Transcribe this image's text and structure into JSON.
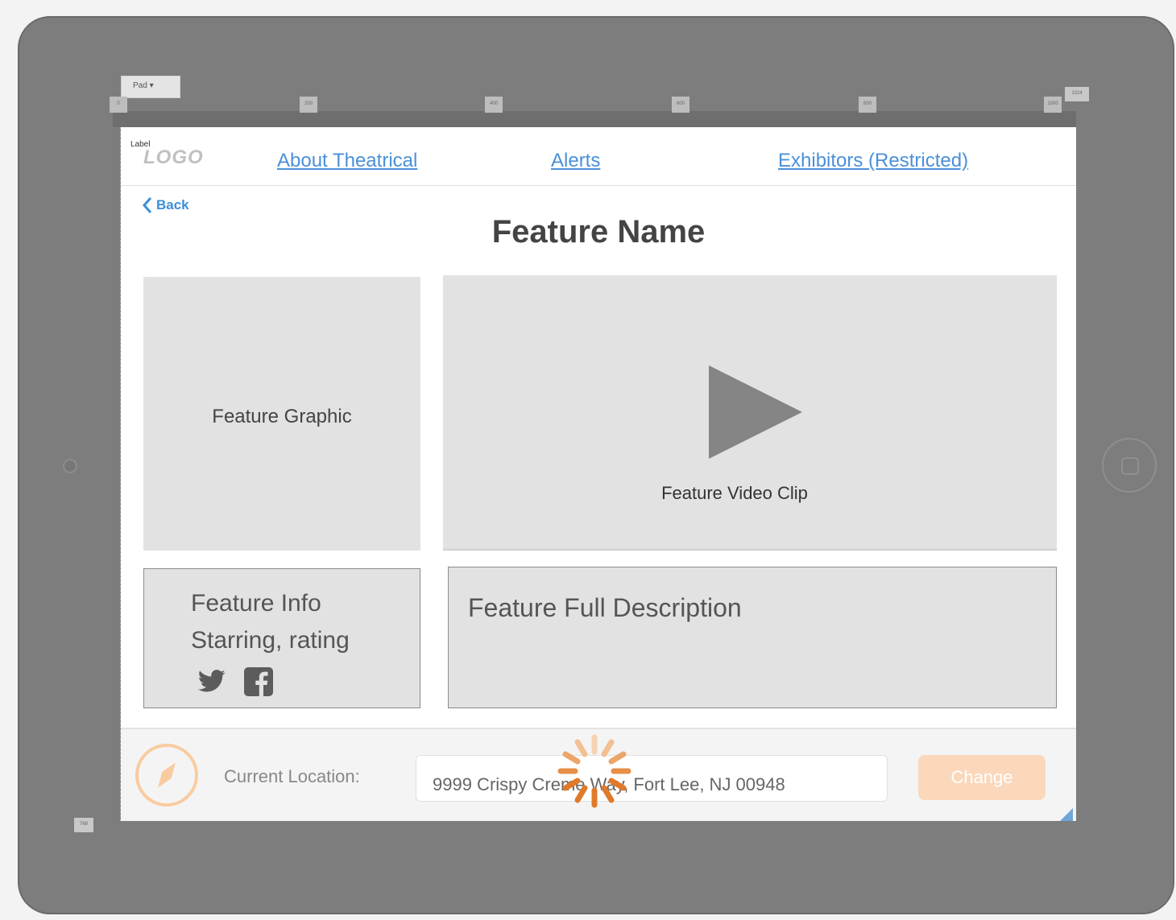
{
  "toolbar": {
    "device_select": "Pad ▾",
    "ruler_ticks": [
      "0",
      "200",
      "400",
      "600",
      "800",
      "1000"
    ],
    "corner_tag": "1024",
    "bottom_tag": "768"
  },
  "screen": {
    "label_tag": "Label",
    "logo": "LOGO",
    "nav": [
      "About Theatrical",
      "Alerts",
      "Exhibitors (Restricted)"
    ],
    "back_label": "Back",
    "title": "Feature Name"
  },
  "content": {
    "graphic_label": "Feature Graphic",
    "video_label": "Feature Video Clip",
    "info_line1": "Feature Info",
    "info_line2": "Starring, rating",
    "description_label": "Feature Full Description",
    "social_icons": [
      "twitter-icon",
      "facebook-icon"
    ]
  },
  "footer": {
    "location_label": "Current Location:",
    "location_value": "9999 Crispy Creme Way, Fort Lee, NJ 00948",
    "change_label": "Change"
  },
  "colors": {
    "accent_orange": "#e07a2a",
    "link_blue": "#4a90d9",
    "button_disabled": "#fbd8bb"
  }
}
